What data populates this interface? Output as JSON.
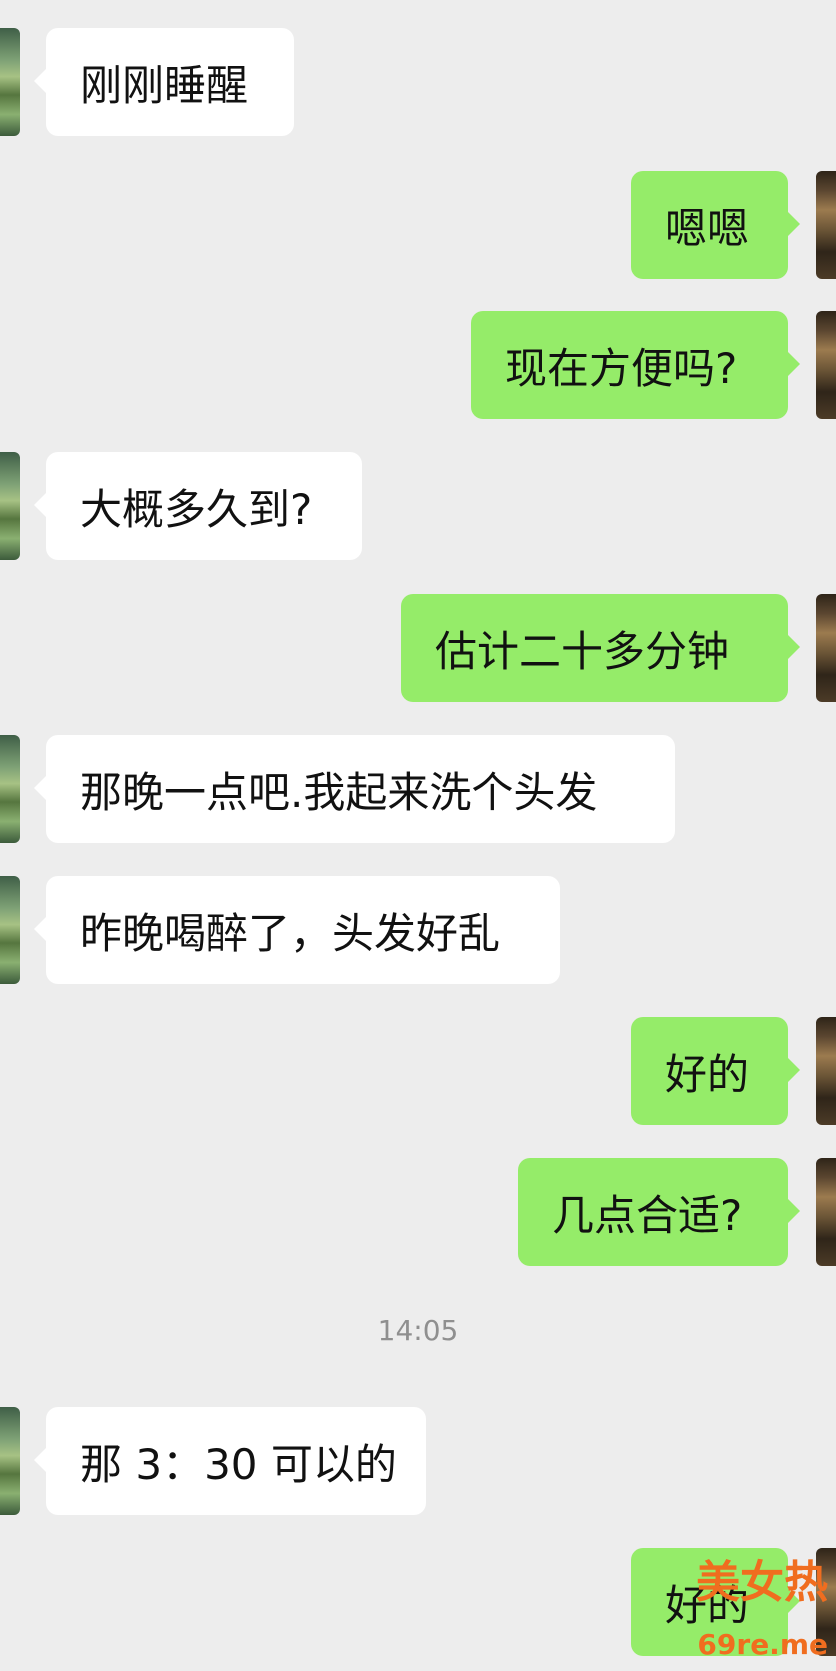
{
  "chat": {
    "messages": [
      {
        "side": "left",
        "text": "刚刚睡醒"
      },
      {
        "side": "right",
        "text": "嗯嗯"
      },
      {
        "side": "right",
        "text": "现在方便吗?"
      },
      {
        "side": "left",
        "text": "大概多久到?"
      },
      {
        "side": "right",
        "text": "估计二十多分钟"
      },
      {
        "side": "left",
        "text": "那晚一点吧.我起来洗个头发"
      },
      {
        "side": "left",
        "text": "昨晚喝醉了，头发好乱"
      },
      {
        "side": "right",
        "text": "好的"
      },
      {
        "side": "right",
        "text": "几点合适?"
      },
      {
        "side": "left",
        "text": "那 3：30 可以的"
      },
      {
        "side": "right",
        "text": "好的"
      }
    ],
    "timestamp": "14:05"
  },
  "watermark": {
    "title": "美女热",
    "domain": "69re.me"
  },
  "colors": {
    "background": "#ededed",
    "incoming_bubble": "#ffffff",
    "outgoing_bubble": "#95ec69",
    "timestamp_text": "#8f8f8f",
    "watermark": "#f06d1f"
  },
  "icons": {
    "incoming_avatar": "contact-avatar-icon",
    "outgoing_avatar": "user-avatar-icon"
  }
}
